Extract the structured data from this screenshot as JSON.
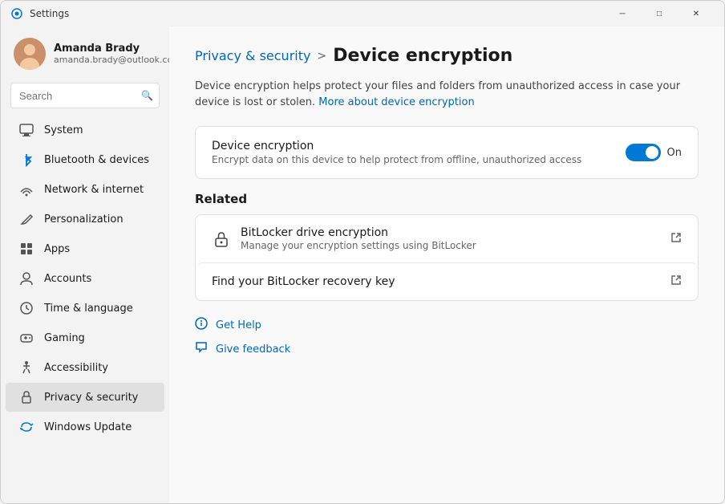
{
  "window": {
    "title": "Settings",
    "controls": {
      "minimize": "─",
      "maximize": "□",
      "close": "✕"
    }
  },
  "sidebar": {
    "user": {
      "name": "Amanda Brady",
      "email": "amanda.brady@outlook.com"
    },
    "search": {
      "placeholder": "Search"
    },
    "nav": [
      {
        "id": "system",
        "label": "System",
        "icon": "🖥"
      },
      {
        "id": "bluetooth",
        "label": "Bluetooth & devices",
        "icon": "🔵"
      },
      {
        "id": "network",
        "label": "Network & internet",
        "icon": "🌐"
      },
      {
        "id": "personalization",
        "label": "Personalization",
        "icon": "✏️"
      },
      {
        "id": "apps",
        "label": "Apps",
        "icon": "📦"
      },
      {
        "id": "accounts",
        "label": "Accounts",
        "icon": "👤"
      },
      {
        "id": "time",
        "label": "Time & language",
        "icon": "🕐"
      },
      {
        "id": "gaming",
        "label": "Gaming",
        "icon": "🎮"
      },
      {
        "id": "accessibility",
        "label": "Accessibility",
        "icon": "♿"
      },
      {
        "id": "privacy",
        "label": "Privacy & security",
        "icon": "🔒",
        "active": true
      },
      {
        "id": "update",
        "label": "Windows Update",
        "icon": "🔄"
      }
    ]
  },
  "content": {
    "breadcrumb": {
      "parent": "Privacy & security",
      "separator": ">",
      "current": "Device encryption"
    },
    "description": {
      "text": "Device encryption helps protect your files and folders from unauthorized access in case your device is lost or stolen.",
      "link_text": "More about device encryption"
    },
    "device_encryption": {
      "title": "Device encryption",
      "description": "Encrypt data on this device to help protect from offline, unauthorized access",
      "toggle_state": true,
      "toggle_label": "On"
    },
    "related": {
      "title": "Related",
      "items": [
        {
          "id": "bitlocker",
          "icon": "🔐",
          "title": "BitLocker drive encryption",
          "description": "Manage your encryption settings using BitLocker",
          "external": true
        },
        {
          "id": "recovery-key",
          "title": "Find your BitLocker recovery key",
          "external": true
        }
      ]
    },
    "help": {
      "get_help": "Get Help",
      "give_feedback": "Give feedback"
    }
  }
}
